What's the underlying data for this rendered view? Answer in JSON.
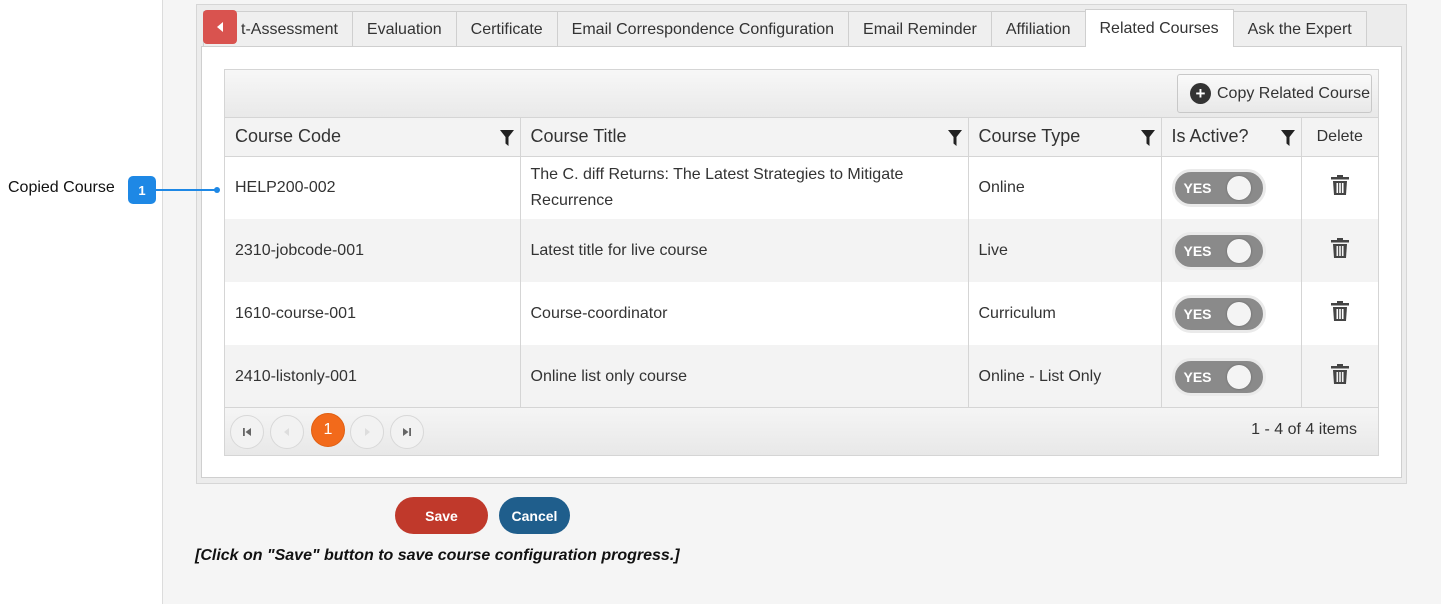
{
  "tabs": [
    {
      "label": "t-Assessment",
      "active": false
    },
    {
      "label": "Evaluation",
      "active": false
    },
    {
      "label": "Certificate",
      "active": false
    },
    {
      "label": "Email Correspondence Configuration",
      "active": false
    },
    {
      "label": "Email Reminder",
      "active": false
    },
    {
      "label": "Affiliation",
      "active": false
    },
    {
      "label": "Related Courses",
      "active": true
    },
    {
      "label": "Ask the Expert",
      "active": false
    }
  ],
  "toolbar": {
    "copy_label": "Copy Related Course"
  },
  "columns": {
    "code": "Course Code",
    "title": "Course Title",
    "type": "Course Type",
    "active": "Is Active?",
    "delete": "Delete"
  },
  "rows": [
    {
      "code": "HELP200-002",
      "title": "The C. diff Returns: The Latest Strategies to Mitigate Recurrence",
      "type": "Online",
      "active": "YES"
    },
    {
      "code": "2310-jobcode-001",
      "title": "Latest title for live course",
      "type": "Live",
      "active": "YES"
    },
    {
      "code": "1610-course-001",
      "title": "Course-coordinator",
      "type": "Curriculum",
      "active": "YES"
    },
    {
      "code": "2410-listonly-001",
      "title": "Online list only course",
      "type": "Online - List Only",
      "active": "YES"
    }
  ],
  "pager": {
    "current_page": "1",
    "info": "1 - 4 of 4 items"
  },
  "actions": {
    "save": "Save",
    "cancel": "Cancel"
  },
  "note": "[Click on \"Save\" button to save course configuration progress.]",
  "callout": {
    "label": "Copied Course",
    "badge": "1"
  },
  "colors": {
    "accent_red": "#c0392b",
    "accent_blue": "#1f5e8c",
    "page_current": "#f26a1b",
    "callout": "#1e88e5"
  }
}
